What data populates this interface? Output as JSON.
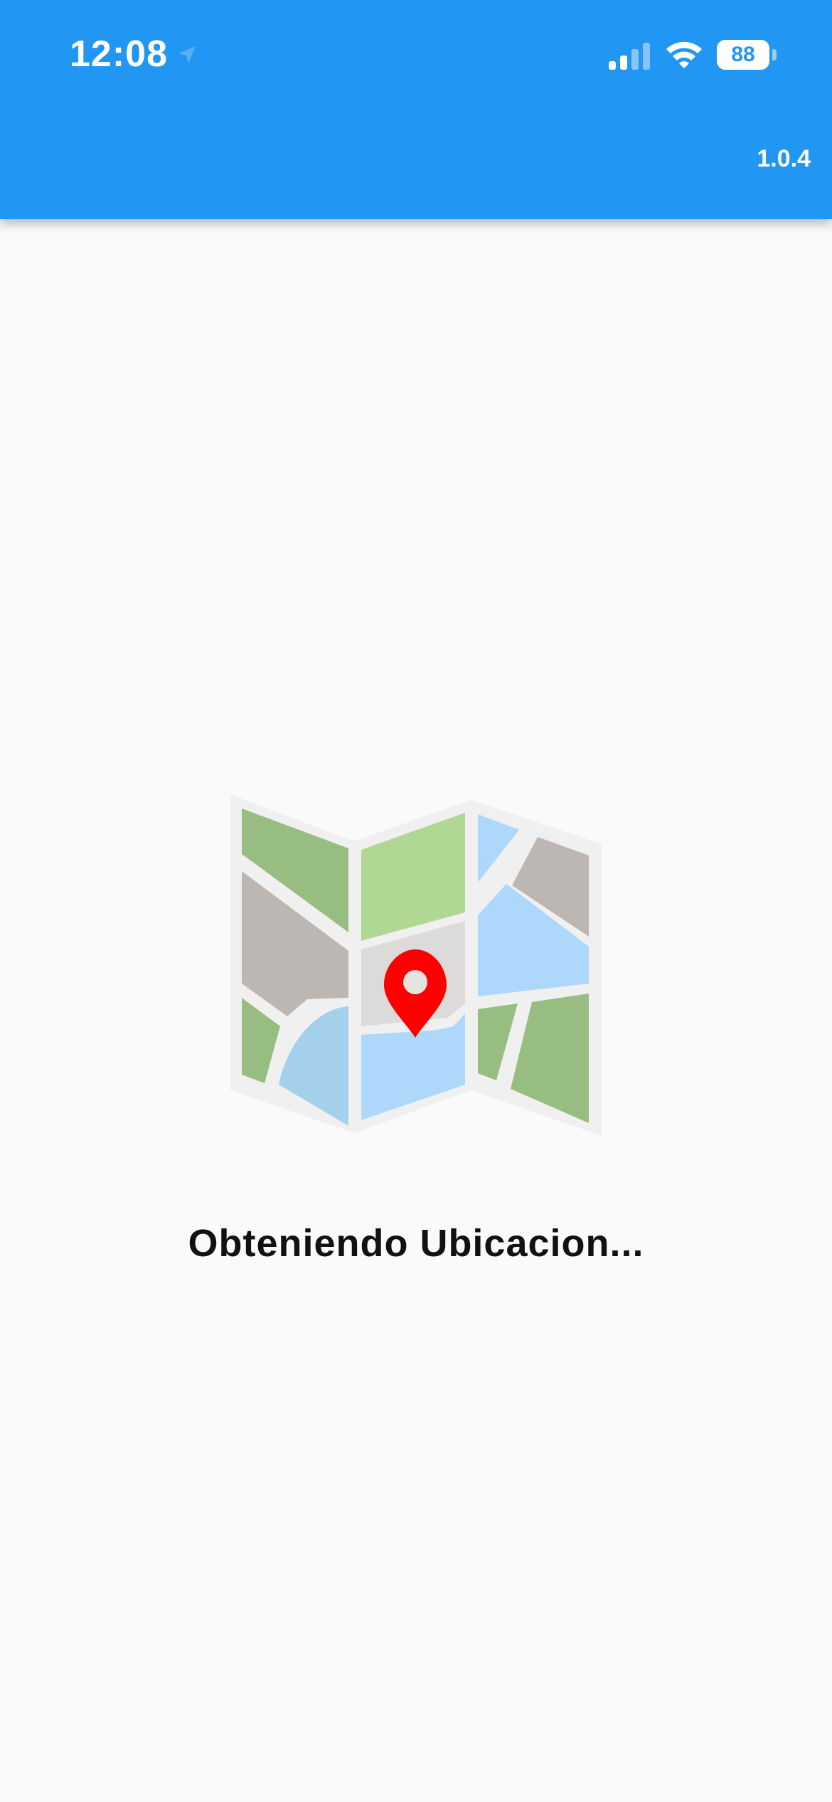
{
  "status_bar": {
    "time": "12:08",
    "battery_level": "88",
    "icons": [
      "location-arrow-icon",
      "cellular-signal-icon",
      "wifi-icon",
      "battery-icon"
    ]
  },
  "app_bar": {
    "version": "1.0.4",
    "color": "#2196f3"
  },
  "main": {
    "illustration": "folded-map-with-location-pin",
    "loading_message": "Obteniendo Ubicacion..."
  },
  "colors": {
    "pin": "#ff0000",
    "background": "#fafafa"
  }
}
